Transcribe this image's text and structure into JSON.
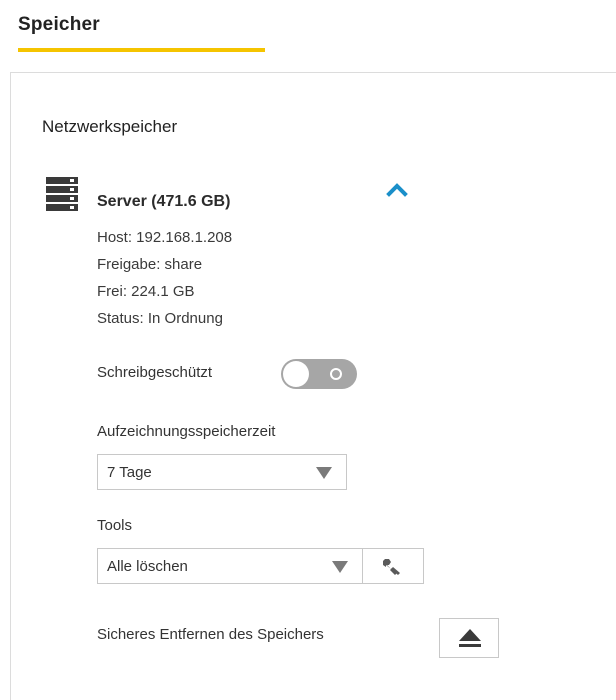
{
  "header": {
    "title": "Speicher",
    "accent_color": "#f5c400"
  },
  "section": {
    "title": "Netzwerkspeicher"
  },
  "server": {
    "icon": "server-icon",
    "name": "Server (471.6 GB)",
    "collapse_icon": "chevron-up-icon",
    "accent_color": "#1a8fc9",
    "host": "Host: 192.168.1.208",
    "share": "Freigabe: share",
    "free": "Frei: 224.1 GB",
    "status": "Status: In Ordnung"
  },
  "readonly": {
    "label": "Schreibgeschützt",
    "enabled": false
  },
  "recording": {
    "label": "Aufzeichnungsspeicherzeit",
    "selected": "7 Tage"
  },
  "tools": {
    "label": "Tools",
    "selected": "Alle löschen",
    "button_icon": "wrench-icon"
  },
  "eject": {
    "label": "Sicheres Entfernen des Speichers",
    "button_icon": "eject-icon"
  }
}
